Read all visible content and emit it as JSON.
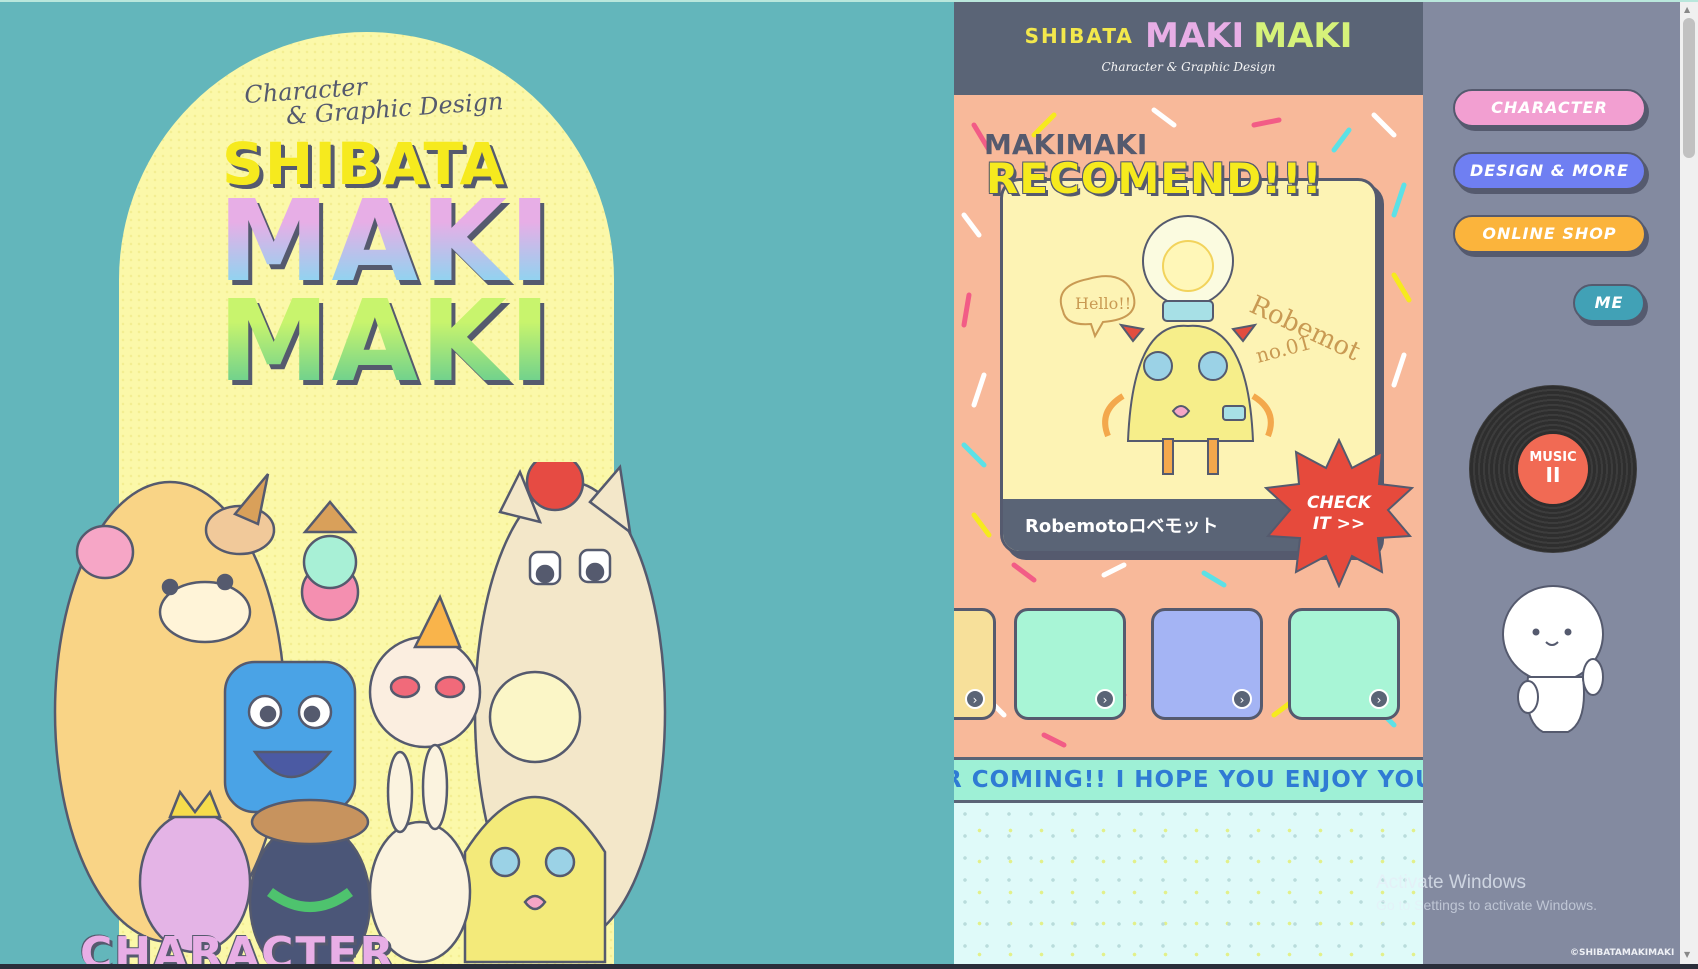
{
  "hero": {
    "tagline_line1": "Character",
    "tagline_line2": "& Graphic Design",
    "logo_shibata": "SHIBATA",
    "logo_maki1": "MAKI",
    "logo_maki2": "MAKI"
  },
  "center_header": {
    "shibata": "SHIBATA",
    "maki1": "MAKI",
    "maki2": "MAKI",
    "subtitle": "Character & Graphic Design"
  },
  "recommend": {
    "small": "MAKIMAKI",
    "big": "RECOMEND!!!",
    "card_name": "Robemotoロベモット",
    "check_line1": "CHECK",
    "check_line2": "IT >>",
    "art_hello": "Hello!!",
    "art_title": "Robemot",
    "art_no": "no.01"
  },
  "thumbnails": [
    {
      "color": "#f7e09a",
      "arrow": "›"
    },
    {
      "color": "#a8f5d6",
      "arrow": "›"
    },
    {
      "color": "#a4b4f4",
      "arrow": "›"
    },
    {
      "color": "#a8f5d6",
      "arrow": "›"
    }
  ],
  "marquee_text": "R COMING!! I HOPE YOU ENJOY YOUR T",
  "section_heading": "CHARACTER",
  "nav": {
    "character": "CHARACTER",
    "design": "DESIGN & MORE",
    "shop": "ONLINE SHOP",
    "me": "ME"
  },
  "music": {
    "label": "MUSIC",
    "state_icon": "II"
  },
  "windows_watermark": {
    "line1": "Activate Windows",
    "line2": "Go to Settings to activate Windows."
  },
  "copyright": "©SHIBATAMAKIMAKI",
  "colors": {
    "teal_bg": "#63b6bb",
    "arch_yellow": "#fbf8a9",
    "panel_peach": "#f8b99a",
    "header_slate": "#5a6476",
    "sidebar_gray": "#838aa0",
    "pink": "#f29fd1",
    "blue": "#6f7ff2",
    "orange": "#fbb43c",
    "teal_btn": "#41a1b6",
    "record_red": "#f16a54"
  }
}
